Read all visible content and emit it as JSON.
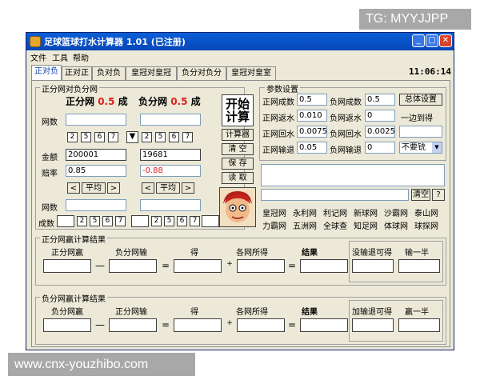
{
  "watermarks": {
    "top": "TG: MYYJJPP",
    "bottom": "www.cnx-youzhibo.com"
  },
  "window": {
    "title": "足球篮球打水计算器 1.01 (已注册)",
    "min": "_",
    "max": "□",
    "close": "✕"
  },
  "menu": [
    "文件",
    "工具",
    "帮助"
  ],
  "clock": "11:06:14",
  "tabs": [
    "正对负",
    "正对正",
    "负对负",
    "皇冠对皇冠",
    "负分对负分",
    "皇冠对皇室"
  ],
  "calc": {
    "group_label": "正分网对负分网",
    "left_title": "正分网",
    "right_title": "负分网",
    "rate": "0.5",
    "unit": "成",
    "net_count_label": "网数",
    "amount_label": "金额",
    "odds_label": "赔率",
    "left_amount": "200001",
    "right_amount": "19681",
    "left_odds": "0.85",
    "right_odds": "-0.88",
    "avg_label": "平均",
    "lt": "<",
    "gt": ">",
    "down_arrow": "▼",
    "small_btns": [
      "2",
      "5",
      "6",
      "7"
    ],
    "net_count_label2": "网数",
    "percent_label": "成数"
  },
  "actions": {
    "start": "开始",
    "calc": "计算",
    "calculator": "计算器",
    "clear": "清 空",
    "save": "保 存",
    "read": "读 取"
  },
  "params": {
    "group_label": "参数设置",
    "rows": [
      {
        "l1": "正网成数",
        "v1": "0.5",
        "l2": "负网成数",
        "v2": "0.5"
      },
      {
        "l1": "正网返水",
        "v1": "0.010",
        "l2": "负网返水",
        "v2": "0"
      },
      {
        "l1": "正网回水",
        "v1": "0.0075",
        "l2": "负网回水",
        "v2": "0.0025"
      },
      {
        "l1": "正网输退",
        "v1": "0.05",
        "l2": "负网输退",
        "v2": "0"
      }
    ],
    "overall": "总体设置",
    "side_text": "一边到得",
    "dropdown": "不要铳",
    "dropdown_arrow": "▼",
    "clear": "清空",
    "help": "?"
  },
  "links": [
    [
      "皇冠网",
      "永利网",
      "利记网",
      "新球网",
      "沙霸网",
      "泰山网"
    ],
    [
      "力霸网",
      "五洲网",
      "全球查",
      "知足网",
      "体球网",
      "球探网"
    ]
  ],
  "result1": {
    "group_label": "正分网赢计算结果",
    "labels": [
      "正分网赢",
      "负分网输",
      "得",
      "各网所得",
      "结果"
    ],
    "extra": [
      "没输退可得",
      "输一半"
    ],
    "minus": "—",
    "equals": "=",
    "plus": "+"
  },
  "result2": {
    "group_label": "负分网赢计算结果",
    "labels": [
      "负分网赢",
      "正分网输",
      "得",
      "各网所得",
      "结果"
    ],
    "extra": [
      "加输退可得",
      "赢一半"
    ],
    "minus": "—",
    "equals": "=",
    "plus": "+"
  }
}
